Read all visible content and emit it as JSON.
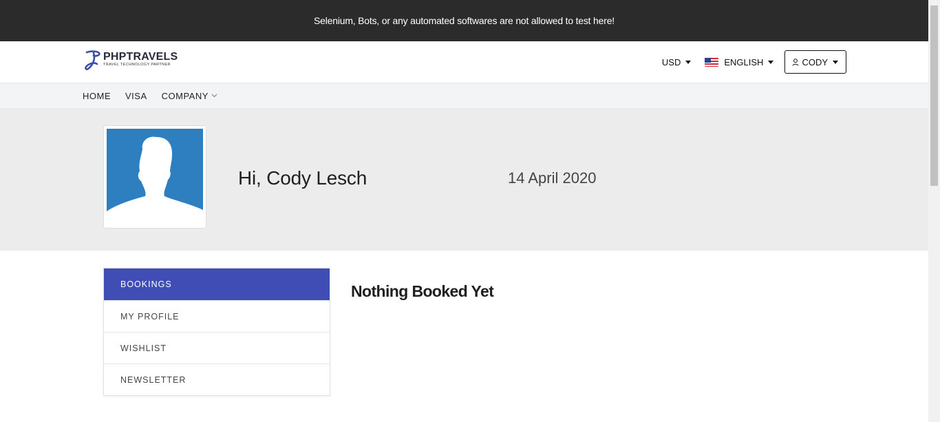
{
  "notice": {
    "text": "Selenium, Bots, or any automated softwares are not allowed to test here!"
  },
  "header": {
    "logo": {
      "title": "PHPTRAVELS",
      "subtitle": "TRAVEL TECHNOLOGY PARTNER",
      "icon": "logo-mark"
    },
    "currency": "USD",
    "language": "ENGLISH",
    "language_icon": "us-flag-icon",
    "user": {
      "label": "CODY",
      "icon": "user-icon"
    }
  },
  "nav": {
    "items": [
      {
        "label": "HOME"
      },
      {
        "label": "VISA"
      },
      {
        "label": "COMPANY",
        "icon": "chevron-down-icon"
      }
    ]
  },
  "profile": {
    "greeting": "Hi, Cody Lesch",
    "date": "14 April 2020",
    "avatar_color": "#2d7fc0"
  },
  "sidebar": {
    "items": [
      {
        "label": "BOOKINGS",
        "active": true
      },
      {
        "label": "MY PROFILE",
        "active": false
      },
      {
        "label": "WISHLIST",
        "active": false
      },
      {
        "label": "NEWSLETTER",
        "active": false
      }
    ]
  },
  "main": {
    "empty_title": "Nothing Booked Yet"
  },
  "colors": {
    "accent": "#3f4db5",
    "notice_bg": "#2b2b2b",
    "hero_bg": "#ececec"
  }
}
